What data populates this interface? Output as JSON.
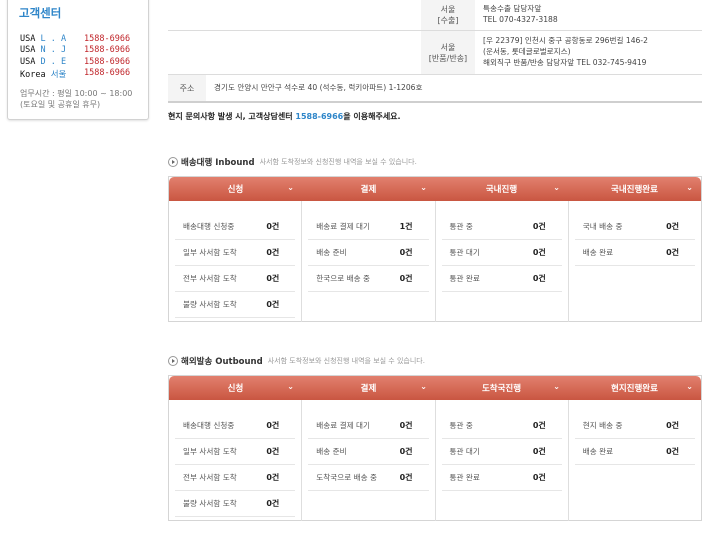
{
  "customer_center": {
    "title": "고객센터",
    "rows": [
      {
        "prefix": "USA ",
        "region": "L . A",
        "phone": "1588-6966"
      },
      {
        "prefix": "USA ",
        "region": "N . J",
        "phone": "1588-6966"
      },
      {
        "prefix": "USA ",
        "region": "D . E",
        "phone": "1588-6966"
      },
      {
        "prefix": "Korea ",
        "region": "서울",
        "phone": "1588-6966"
      }
    ],
    "hours_line1": "업무시간 : 평일 10:00 ~ 18:00",
    "hours_line2": "(토요일 및 공휴일 휴무)"
  },
  "addresses": {
    "seoul_export": {
      "label_line1": "서울",
      "label_line2": "[수출]",
      "line1": "특송수출 담당자앞",
      "line2": "TEL 070-4327-3188"
    },
    "seoul_return": {
      "label_line1": "서울",
      "label_line2": "[반품/반송]",
      "line1": "[우 22379] 인천시 중구 공항동로 296번길 146-2",
      "line2": "(운서동, 롯데글로벌로지스)",
      "line3": "해외직구 반품/반송 담당자앞 TEL 032-745-9419"
    },
    "address": {
      "label": "주소",
      "value": "경기도 안양시 만안구 석수로 40 (석수동, 럭키아파트) 1-1206호"
    }
  },
  "notice": {
    "before": "현지 문의사항 발생 시, 고객상담센터 ",
    "number": "1588-6966",
    "after": "을 이용해주세요."
  },
  "inbound": {
    "title": "배송대행 Inbound",
    "desc": "사서함 도착정보와 신청진행 내역을 보실 수 있습니다.",
    "columns": [
      {
        "header": "신청",
        "items": [
          {
            "label": "배송대행 신청중",
            "count": "0건"
          },
          {
            "label": "일부 사서함 도착",
            "count": "0건"
          },
          {
            "label": "전부 사서함 도착",
            "count": "0건"
          },
          {
            "label": "불량 사서함 도착",
            "count": "0건"
          }
        ]
      },
      {
        "header": "결제",
        "items": [
          {
            "label": "배송료 결제 대기",
            "count": "1건"
          },
          {
            "label": "배송 준비",
            "count": "0건"
          },
          {
            "label": "한국으로 배송 중",
            "count": "0건"
          }
        ]
      },
      {
        "header": "국내진행",
        "items": [
          {
            "label": "통관 중",
            "count": "0건"
          },
          {
            "label": "통관 대기",
            "count": "0건"
          },
          {
            "label": "통관 완료",
            "count": "0건"
          }
        ]
      },
      {
        "header": "국내진행완료",
        "items": [
          {
            "label": "국내 배송 중",
            "count": "0건"
          },
          {
            "label": "배송 완료",
            "count": "0건"
          }
        ]
      }
    ]
  },
  "outbound": {
    "title": "해외발송 Outbound",
    "desc": "사서함 도착정보와 신청진행 내역을 보실 수 있습니다.",
    "columns": [
      {
        "header": "신청",
        "items": [
          {
            "label": "배송대행 신청중",
            "count": "0건"
          },
          {
            "label": "일부 사서함 도착",
            "count": "0건"
          },
          {
            "label": "전부 사서함 도착",
            "count": "0건"
          },
          {
            "label": "불량 사서함 도착",
            "count": "0건"
          }
        ]
      },
      {
        "header": "결제",
        "items": [
          {
            "label": "배송료 결제 대기",
            "count": "0건"
          },
          {
            "label": "배송 준비",
            "count": "0건"
          },
          {
            "label": "도착국으로 배송 중",
            "count": "0건"
          }
        ]
      },
      {
        "header": "도착국진행",
        "items": [
          {
            "label": "통관 중",
            "count": "0건"
          },
          {
            "label": "통관 대기",
            "count": "0건"
          },
          {
            "label": "통관 완료",
            "count": "0건"
          }
        ]
      },
      {
        "header": "현지진행완료",
        "items": [
          {
            "label": "현지 배송 중",
            "count": "0건"
          },
          {
            "label": "배송 완료",
            "count": "0건"
          }
        ]
      }
    ]
  },
  "colors": {
    "accent_blue": "#2f86c9",
    "phone_red": "#c0262b",
    "panel_header": "#d4624d"
  }
}
